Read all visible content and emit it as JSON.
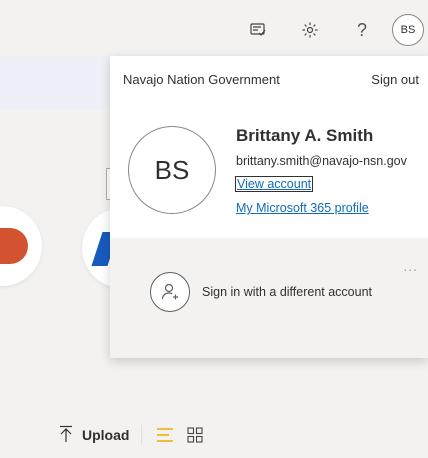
{
  "header": {
    "icons": [
      "feedback-icon",
      "settings-icon",
      "help-icon"
    ],
    "help_glyph": "?",
    "avatar_initials": "BS"
  },
  "account_panel": {
    "organization": "Navajo Nation Government",
    "sign_out_label": "Sign out",
    "avatar_initials": "BS",
    "user_name": "Brittany A. Smith",
    "user_email": "brittany.smith@navajo-nsn.gov",
    "view_account_label": "View account",
    "m365_profile_label": "My Microsoft 365 profile",
    "more_options_glyph": "...",
    "other_account_label": "Sign in with a different account"
  },
  "toolbar": {
    "upload_label": "Upload"
  },
  "colors": {
    "link": "#0f6cbd",
    "powerpoint": "#d35230",
    "word": "#185abd",
    "list_view_accent": "#f2a900"
  }
}
